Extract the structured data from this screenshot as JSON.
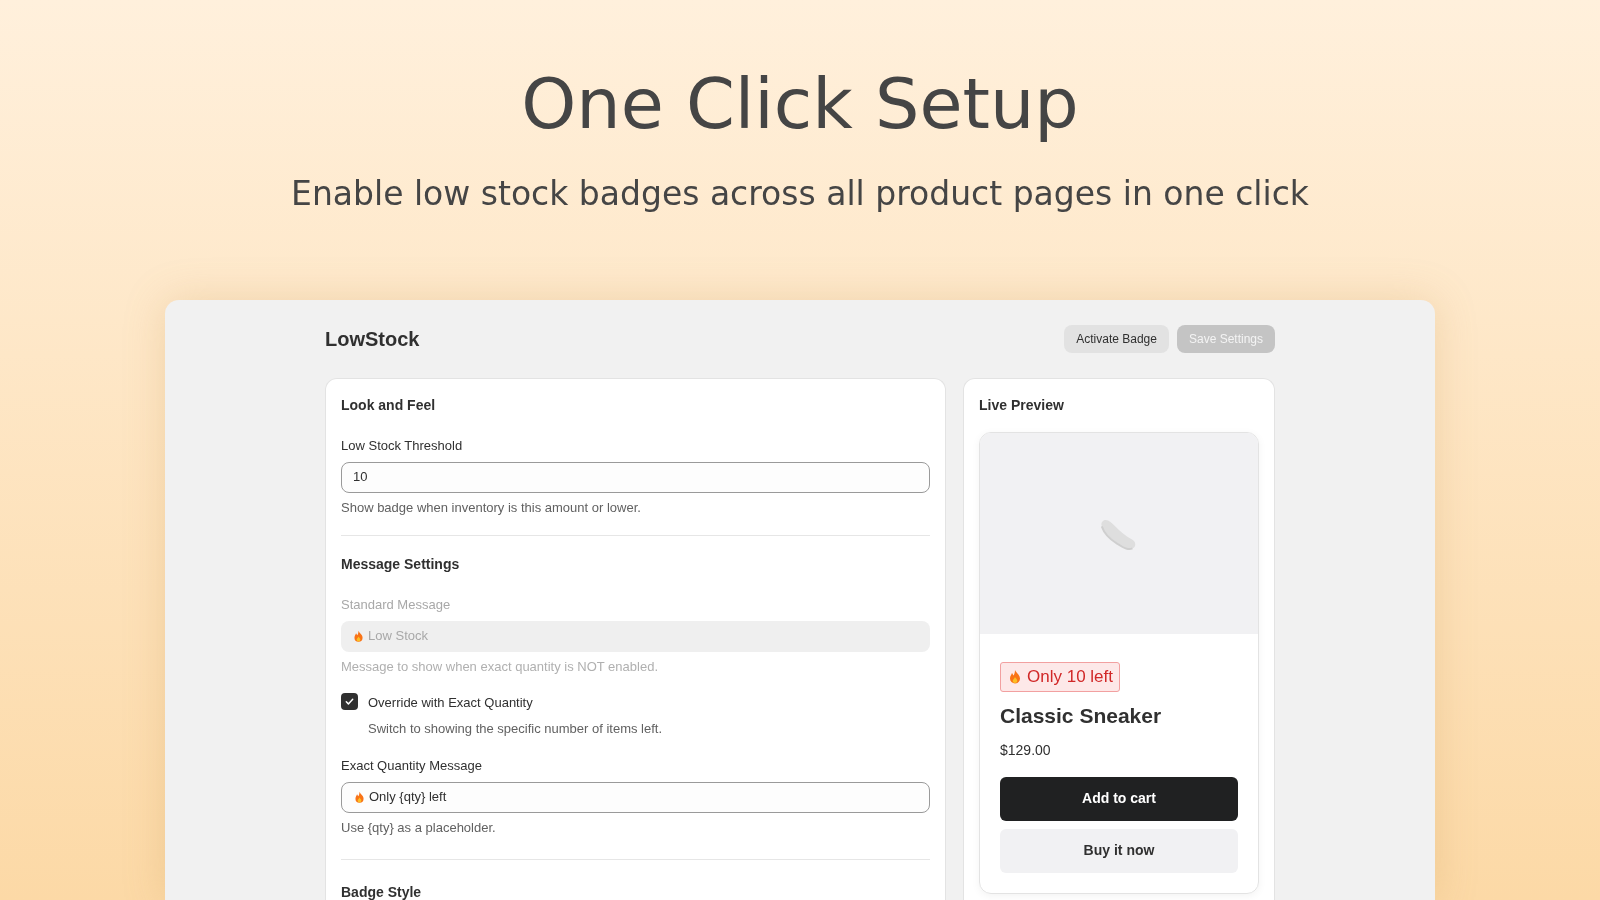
{
  "hero": {
    "title": "One Click Setup",
    "subtitle": "Enable low stock badges across all product pages in one click"
  },
  "app": {
    "title": "LowStock",
    "buttons": [
      {
        "label": "Activate Badge",
        "disabled": false
      },
      {
        "label": "Save Settings",
        "disabled": true
      }
    ]
  },
  "settings": {
    "title": "Look and Feel",
    "threshold": {
      "label": "Low Stock Threshold",
      "value": "10",
      "help": "Show badge when inventory is this amount or lower."
    },
    "message_section": "Message Settings",
    "standard": {
      "label": "Standard Message",
      "value": "Low Stock",
      "disabled": true,
      "help": "Message to show when exact quantity is NOT enabled."
    },
    "override": {
      "label": "Override with Exact Quantity",
      "checked": true,
      "help": "Switch to showing the specific number of items left."
    },
    "exact": {
      "label": "Exact Quantity Message",
      "value": "Only {qty} left",
      "disabled": false,
      "help": "Use {qty} as a placeholder."
    },
    "badge_section": "Badge Style"
  },
  "preview": {
    "title": "Live Preview",
    "badge": "Only 10 left",
    "product": "Classic Sneaker",
    "price": "$129.00",
    "buttons": [
      {
        "label": "Add to cart",
        "kind": "primary"
      },
      {
        "label": "Buy it now",
        "kind": "secondary"
      }
    ]
  }
}
